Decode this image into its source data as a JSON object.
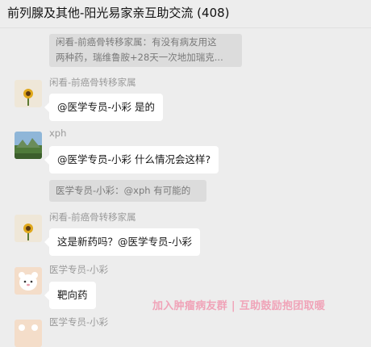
{
  "window": {
    "title": "前列腺及其他-阳光易家亲互助交流 (408)"
  },
  "quote_top": {
    "line1": "闲看-前癌骨转移家属：有没有病友用这",
    "line2": "两种药，瑞维鲁胺+28天一次地加瑞克..."
  },
  "messages": [
    {
      "sender": "闲看-前癌骨转移家属",
      "text": "@医学专员-小彩 是的"
    },
    {
      "sender": "xph",
      "text": "@医学专员-小彩 什么情况会这样?"
    },
    {
      "sender": "闲看-前癌骨转移家属",
      "text": "这是新药吗？@医学专员-小彩"
    },
    {
      "sender": "医学专员-小彩",
      "text": "靶向药"
    },
    {
      "sender": "医学专员-小彩"
    }
  ],
  "quote_reply": {
    "text": "医学专员-小彩：@xph 有可能的"
  },
  "watermark": {
    "text": "加入肿瘤病友群 | 互助鼓励抱团取暖"
  },
  "colors": {
    "background": "#ededed",
    "bubble": "#ffffff",
    "quote": "#dcdcdc",
    "watermark": "#f0a3b8"
  },
  "icons": [
    "avatar-sunflower",
    "avatar-landscape",
    "avatar-sunflower",
    "avatar-white-bear",
    "avatar-white-bear"
  ]
}
